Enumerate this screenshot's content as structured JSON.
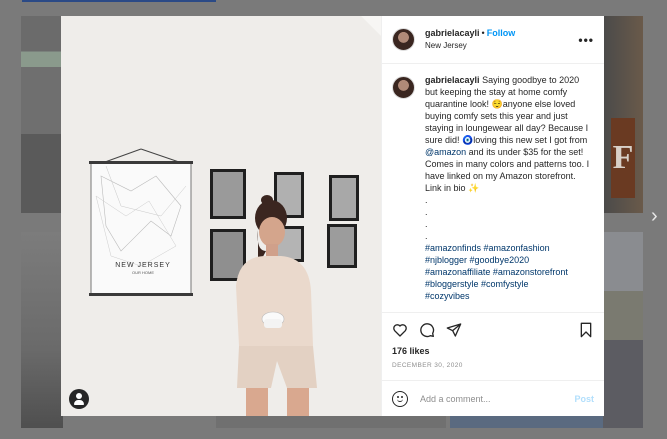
{
  "post": {
    "username": "gabrielacayli",
    "follow_label": "Follow",
    "location": "New Jersey",
    "more_label": "•••",
    "caption_text": "Saying goodbye to 2020 but keeping the stay at home comfy quarantine look! 😌anyone else loved buying comfy sets this year and just staying in loungewear all day? Because I sure did! 🧿loving this new set I got from",
    "caption_mention": "@amazon",
    "caption_text2": "and its under $35 for the set! Comes in many colors and patterns too. I have linked on my Amazon storefront. Link in bio ✨",
    "dots": [
      ".",
      ".",
      ".",
      "."
    ],
    "hashtags_line1": "#amazonfinds #amazonfashion",
    "hashtags_line2": "#njblogger #goodbye2020",
    "hashtags_line3": "#amazonaffiliate #amazonstorefront",
    "hashtags_line4": "#bloggerstyle #comfystyle",
    "hashtags_line5": "#cozyvibes",
    "likes": "176 likes",
    "date": "DECEMBER 30, 2020",
    "comment_placeholder": "Add a comment...",
    "post_label": "Post"
  },
  "photo": {
    "map_title": "NEW JERSEY",
    "map_subtitle": "OUR HOME"
  },
  "icons": {
    "like": "heart-icon",
    "comment": "comment-icon",
    "share": "paper-plane-icon",
    "save": "bookmark-icon",
    "emoji": "emoji-icon",
    "next": "chevron-right-icon",
    "tagged_user": "user-icon"
  },
  "colors": {
    "follow": "#0095f6",
    "post_disabled": "#b2dffc",
    "link": "#00376b"
  }
}
